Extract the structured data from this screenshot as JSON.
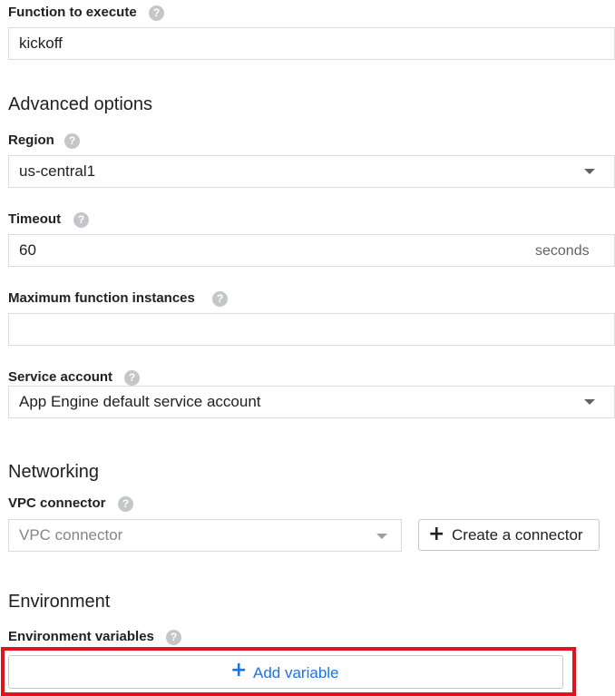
{
  "function_to_execute": {
    "label": "Function to execute",
    "help_icon": "question-icon",
    "value": "kickoff"
  },
  "advanced_options": {
    "title": "Advanced options"
  },
  "region": {
    "label": "Region",
    "help_icon": "question-icon",
    "value": "us-central1",
    "dropdown_icon": "caret-down-icon"
  },
  "timeout": {
    "label": "Timeout",
    "help_icon": "question-icon",
    "value": "60",
    "unit": "seconds"
  },
  "max_instances": {
    "label": "Maximum function instances",
    "help_icon": "question-icon",
    "value": ""
  },
  "service_account": {
    "label": "Service account",
    "help_icon": "question-icon",
    "value": "App Engine default service account",
    "dropdown_icon": "caret-down-icon"
  },
  "networking": {
    "title": "Networking",
    "vpc_label": "VPC connector",
    "help_icon": "question-icon",
    "vpc_placeholder": "VPC connector",
    "create_button": "Create a connector",
    "create_icon": "plus-icon"
  },
  "environment": {
    "title": "Environment",
    "vars_label": "Environment variables",
    "help_icon": "question-icon",
    "add_button": "Add variable",
    "add_icon": "plus-icon"
  },
  "colors": {
    "accent": "#1a73e8",
    "highlight": "#e2131e",
    "border": "#dadce0",
    "help_icon": "#c4c6c9"
  }
}
